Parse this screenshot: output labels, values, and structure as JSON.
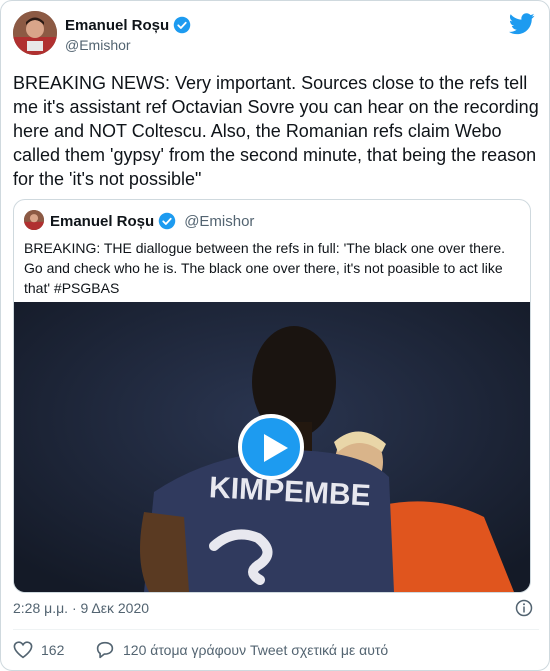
{
  "tweet": {
    "author_name": "Emanuel Roșu",
    "author_handle": "@Emishor",
    "text": "BREAKING NEWS: Very important. Sources close to the refs tell me it's assistant ref Octavian Sovre you can hear on the recording here and NOT Coltescu. Also, the Romanian refs claim Webo called them 'gypsy' from the second minute, that being the reason for the 'it's not possible\"",
    "timestamp": "2:28 μ.μ. · 9 Δεκ 2020",
    "like_count": "162",
    "conversation_text": "120 άτομα γράφουν Tweet σχετικά με αυτό"
  },
  "quoted": {
    "author_name": "Emanuel Roșu",
    "author_handle": "@Emishor",
    "text": "BREAKING: THE diallogue between the refs in full: 'The black one over there. Go and check who he is. The black one over there, it's not poasible to act like that' #PSGBAS",
    "video_jersey_text": "KIMPEMBE"
  },
  "colors": {
    "accent": "#1d9bf0",
    "secondary_text": "#536471",
    "border": "#cfd9de"
  },
  "icons": [
    "verified-icon",
    "twitter-bird-icon",
    "play-icon",
    "info-icon",
    "heart-icon",
    "reply-bubble-icon"
  ]
}
